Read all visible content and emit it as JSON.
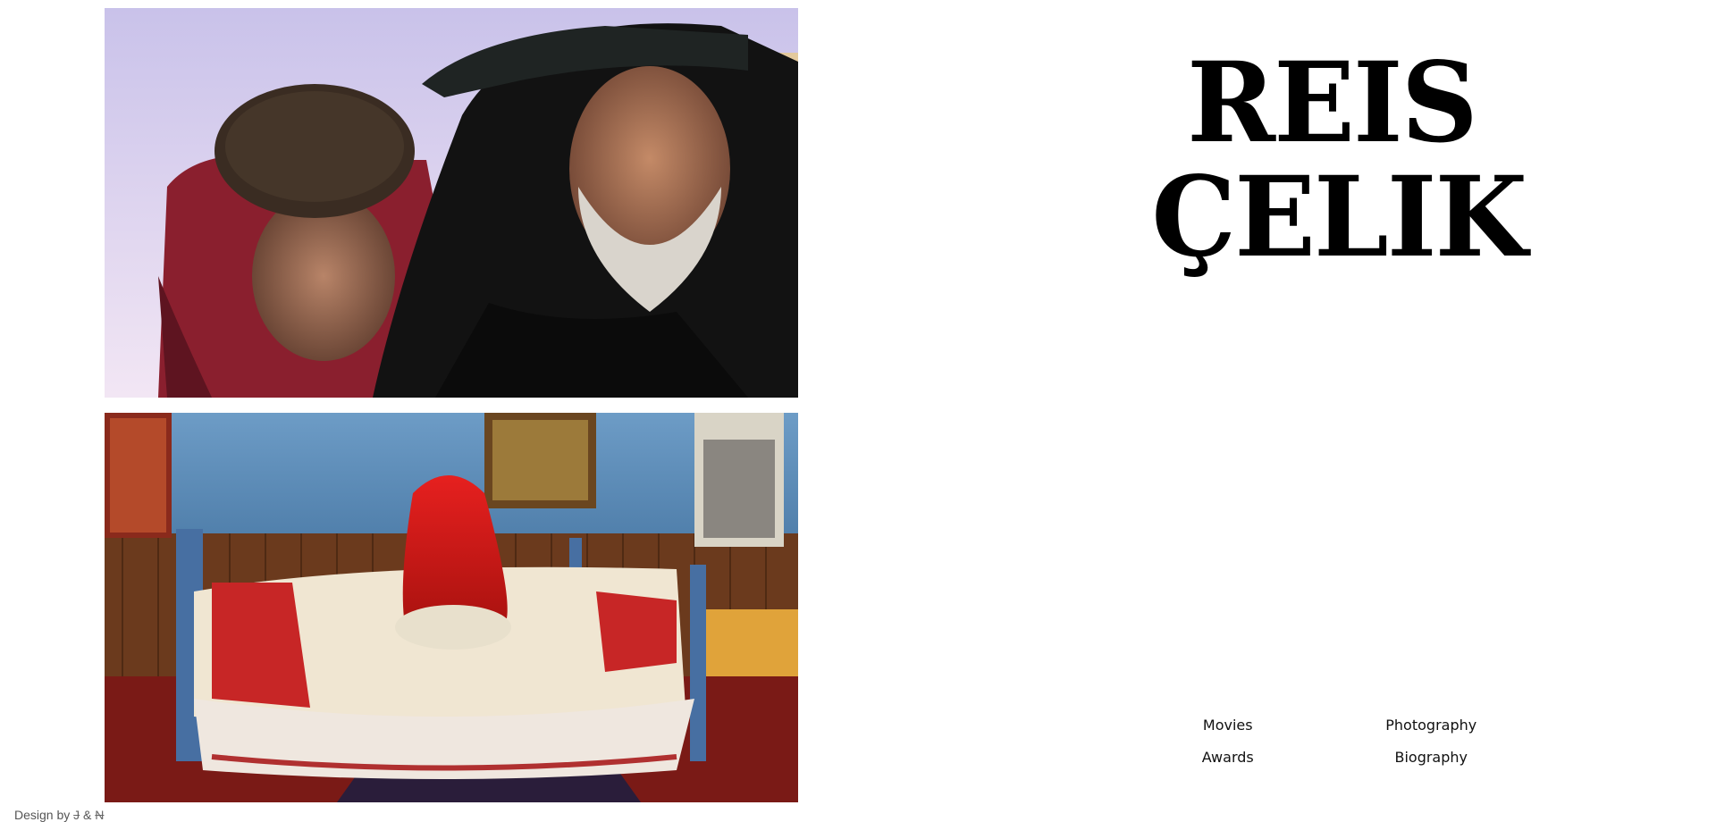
{
  "title": {
    "line1": "REIS",
    "line2": "ÇELIK"
  },
  "gallery": {
    "photos": [
      {
        "name": "photo-elderly-men-in-hats"
      },
      {
        "name": "photo-bride-in-red-veil-on-bed"
      }
    ]
  },
  "nav": {
    "items": [
      {
        "label": "Movies"
      },
      {
        "label": "Photography"
      },
      {
        "label": "Awards"
      },
      {
        "label": "Biography"
      }
    ]
  },
  "footer": {
    "credit_prefix": "Design by",
    "credit_mark_1": "J",
    "credit_amp": "&",
    "credit_mark_2": "N"
  },
  "colors": {
    "background": "#ffffff",
    "text": "#111111",
    "title": "#000000"
  }
}
